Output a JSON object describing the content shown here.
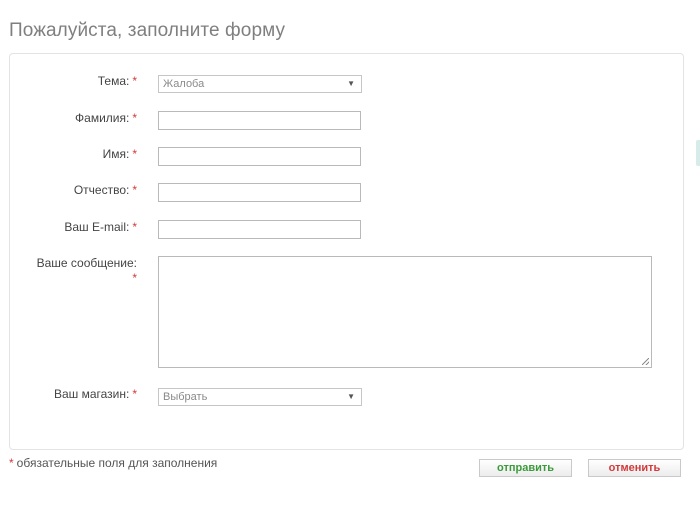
{
  "page": {
    "title": "Пожалуйста, заполните форму"
  },
  "form": {
    "required_mark": "*",
    "topic": {
      "label": "Тема:",
      "selected": "Жалоба"
    },
    "last_name": {
      "label": "Фамилия:",
      "value": ""
    },
    "first_name": {
      "label": "Имя:",
      "value": ""
    },
    "patronymic": {
      "label": "Отчество:",
      "value": ""
    },
    "email": {
      "label": "Ваш E-mail:",
      "value": ""
    },
    "message": {
      "label": "Ваше сообщение:",
      "value": ""
    },
    "store": {
      "label": "Ваш магазин:",
      "selected": "Выбрать"
    }
  },
  "footer": {
    "required_note": "обязательные поля для заполнения",
    "submit_label": "отправить",
    "cancel_label": "отменить"
  },
  "icons": {
    "dropdown_arrow": "chevron-down-icon"
  },
  "colors": {
    "required": "#d23a3a",
    "submit_text": "#3c9a3c",
    "cancel_text": "#d23a3a",
    "title_text": "#7f7f7f"
  }
}
